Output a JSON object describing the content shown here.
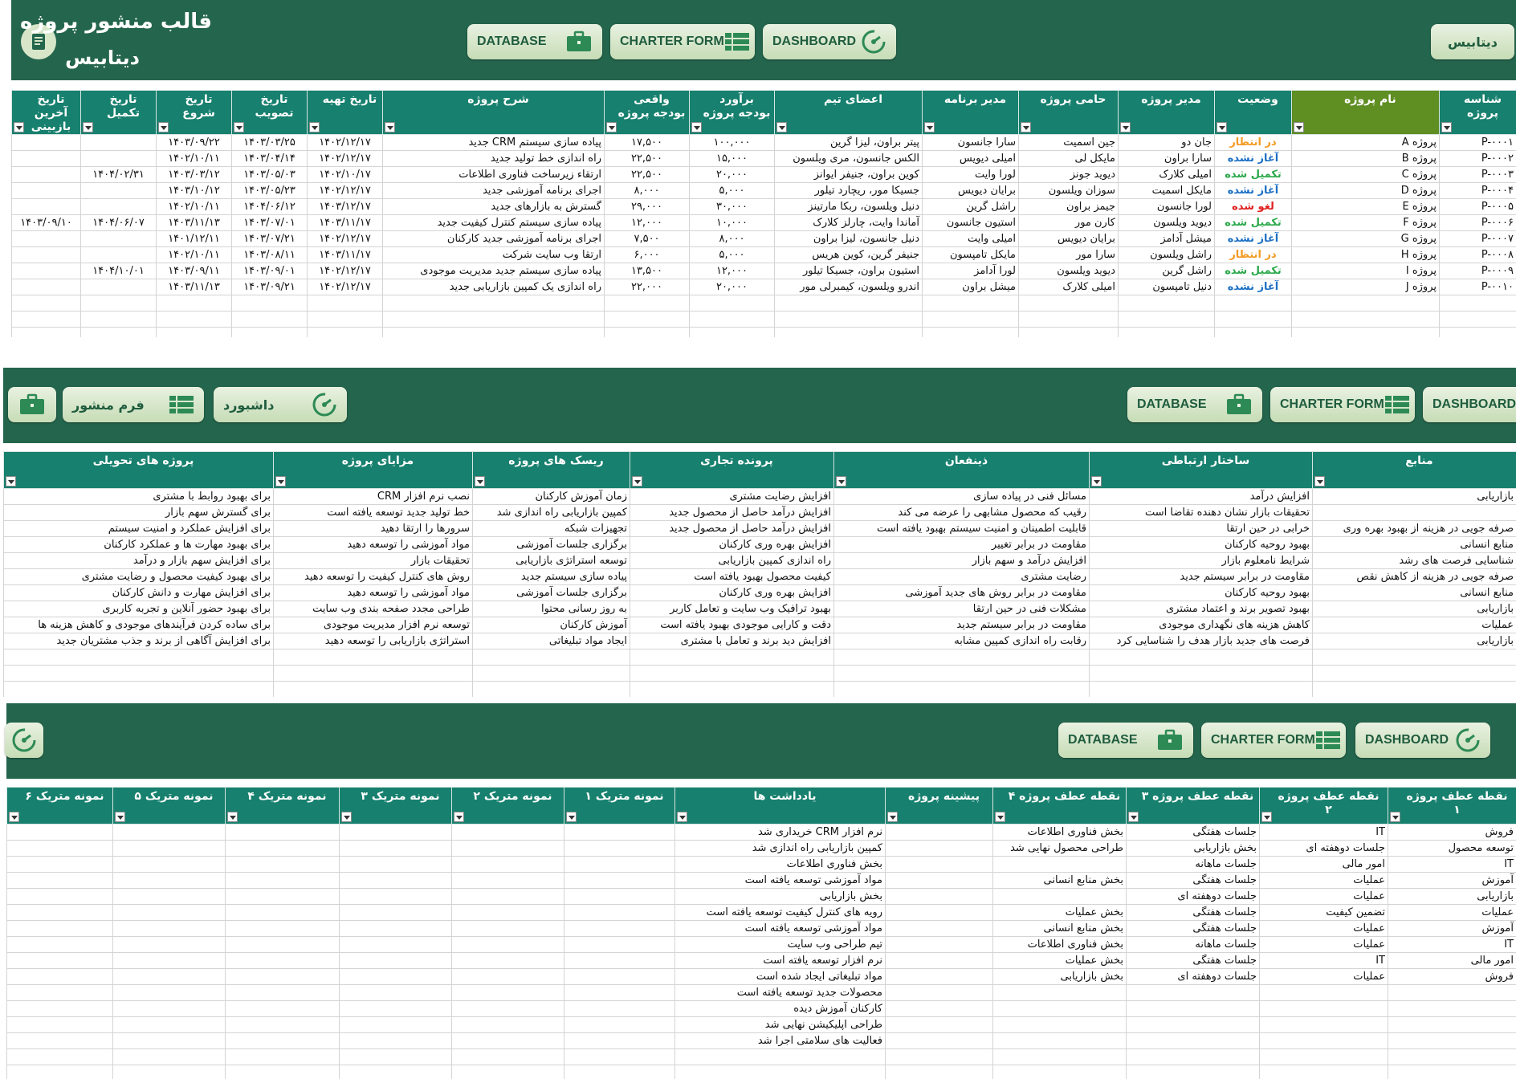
{
  "nav": {
    "database": "DATABASE",
    "charter_form": "CHARTER FORM",
    "dashboard": "DASHBOARD",
    "database_fa": "دیتابیس",
    "charter_fa": "فرم منشور",
    "dashboard_fa": "داشبورد"
  },
  "header": {
    "title": "قالب منشور پروژه",
    "subtitle": "دیتابیس"
  },
  "projects": {
    "headers": [
      "شناسه پروژه",
      "نام پروژه",
      "وضعیت",
      "مدیر پروژه",
      "حامی پروژه",
      "مدیر برنامه",
      "اعضای تیم",
      "برآورد بودجه پروژه",
      "واقعی بودجه پروژه",
      "شرح پروژه",
      "تاریخ تهیه",
      "تاریخ تصویب",
      "تاریخ شروع",
      "تاریخ تکمیل",
      "تاریخ آخرین بازبینی"
    ],
    "rows": [
      [
        "P-۰۰۰۱",
        "پروژه A",
        "در انتظار",
        "جان دو",
        "جین اسمیت",
        "سارا جانسون",
        "پیتر براون، لیزا گرین",
        "۱۰۰,۰۰۰",
        "۱۷,۵۰۰",
        "پیاده سازی سیستم CRM جدید",
        "۱۴۰۲/۱۲/۱۷",
        "۱۴۰۳/۰۳/۲۵",
        "۱۴۰۳/۰۹/۲۲",
        "",
        ""
      ],
      [
        "P-۰۰۰۲",
        "پروژه B",
        "آغاز نشده",
        "سارا براون",
        "مایکل لی",
        "امیلی دیویس",
        "الکس جانسون، مری ویلسون",
        "۱۵,۰۰۰",
        "۲۲,۵۰۰",
        "راه اندازی خط تولید جدید",
        "۱۴۰۲/۱۲/۱۷",
        "۱۴۰۳/۰۴/۱۴",
        "۱۴۰۲/۱۰/۱۱",
        "",
        ""
      ],
      [
        "P-۰۰۰۳",
        "پروژه C",
        "تکمیل شده",
        "امیلی کلارک",
        "دیوید جونز",
        "لورا وایت",
        "کوین براون، جنیفر ایوانز",
        "۲۰,۰۰۰",
        "۲۲,۵۰۰",
        "ارتقاء زیرساخت فناوری اطلاعات",
        "۱۴۰۲/۱۰/۱۷",
        "۱۴۰۳/۰۵/۰۳",
        "۱۴۰۳/۰۳/۱۲",
        "۱۴۰۴/۰۲/۳۱",
        ""
      ],
      [
        "P-۰۰۰۴",
        "پروژه D",
        "آغاز نشده",
        "مایکل اسمیت",
        "سوزان ویلسون",
        "برایان دیویس",
        "جسیکا مور، ریچارد تیلور",
        "۵,۰۰۰",
        "۸,۰۰۰",
        "اجرای برنامه آموزشی جدید",
        "۱۴۰۲/۱۲/۱۷",
        "۱۴۰۳/۰۵/۲۳",
        "۱۴۰۳/۱۰/۱۲",
        "",
        ""
      ],
      [
        "P-۰۰۰۵",
        "پروژه E",
        "لغو شده",
        "لورا جانسون",
        "جیمز براون",
        "راشل گرین",
        "دنیل ویلسون، ربکا مارتینز",
        "۳۰,۰۰۰",
        "۲۹,۰۰۰",
        "گسترش به بازارهای جدید",
        "۱۴۰۳/۱۲/۱۷",
        "۱۴۰۴/۰۶/۱۲",
        "۱۴۰۲/۱۰/۱۱",
        "",
        ""
      ],
      [
        "P-۰۰۰۶",
        "پروژه F",
        "تکمیل شده",
        "دیوید ویلسون",
        "کارن مور",
        "استیون جانسون",
        "آماندا وایت، چارلز کلارک",
        "۱۰,۰۰۰",
        "۱۲,۰۰۰",
        "پیاده سازی سیستم کنترل کیفیت جدید",
        "۱۴۰۳/۱۱/۱۷",
        "۱۴۰۳/۰۷/۰۱",
        "۱۴۰۳/۱۱/۱۳",
        "۱۴۰۴/۰۶/۰۷",
        "۱۴۰۳/۰۹/۱۰"
      ],
      [
        "P-۰۰۰۷",
        "پروژه G",
        "آغاز نشده",
        "میشل آدامز",
        "برایان دیویس",
        "امیلی وایت",
        "دنیل جانسون، لیزا براون",
        "۸,۰۰۰",
        "۷,۵۰۰",
        "اجرای برنامه آموزشی جدید کارکنان",
        "۱۴۰۲/۱۲/۱۷",
        "۱۴۰۳/۰۷/۲۱",
        "۱۴۰۱/۱۲/۱۱",
        "",
        ""
      ],
      [
        "P-۰۰۰۸",
        "پروژه H",
        "در انتظار",
        "راشل ویلسون",
        "سارا مور",
        "مایکل تامپسون",
        "جنیفر گرین، کوین هریس",
        "۵,۰۰۰",
        "۶,۰۰۰",
        "ارتقا وب سایت شرکت",
        "۱۴۰۳/۱۱/۱۷",
        "۱۴۰۳/۰۸/۱۱",
        "۱۴۰۲/۱۰/۱۱",
        "",
        ""
      ],
      [
        "P-۰۰۰۹",
        "پروژه I",
        "تکمیل شده",
        "راشل گرین",
        "دیوید ویلسون",
        "لورا آدامز",
        "استیون براون، جسیکا تیلور",
        "۱۲,۰۰۰",
        "۱۳,۵۰۰",
        "پیاده سازی سیستم جدید مدیریت موجودی",
        "۱۴۰۲/۱۲/۱۷",
        "۱۴۰۳/۰۹/۰۱",
        "۱۴۰۳/۰۹/۱۱",
        "۱۴۰۴/۱۰/۰۱",
        ""
      ],
      [
        "P-۰۰۱۰",
        "پروژه J",
        "آغاز نشده",
        "دنیل تامپسون",
        "امیلی کلارک",
        "میشل براون",
        "اندرو ویلسون، کیمبرلی مور",
        "۲۰,۰۰۰",
        "۲۲,۰۰۰",
        "راه اندازی یک کمپین بازاریابی جدید",
        "۱۴۰۲/۱۲/۱۷",
        "۱۴۰۳/۰۹/۲۱",
        "۱۴۰۳/۱۱/۱۳",
        "",
        ""
      ]
    ]
  },
  "charter": {
    "headers": [
      "منابع",
      "ساختار ارتباطی",
      "ذینفعان",
      "پرونده تجاری",
      "ریسک های پروژه",
      "مزایای پروژه",
      "پروژه های تحویلی"
    ],
    "rows": [
      [
        "بازاریابی",
        "افزایش درآمد",
        "مسائل فنی در پیاده سازی",
        "افزایش رضایت مشتری",
        "زمان آموزش کارکنان",
        "نصب نرم افزار CRM",
        "برای بهبود روابط با مشتری"
      ],
      [
        "",
        "تحقیقات بازار نشان دهنده تقاضا است",
        "رقیب که محصول مشابهی را عرضه می کند",
        "افزایش درآمد حاصل از محصول جدید",
        "کمپین بازاریابی راه اندازی شد",
        "خط تولید جدید توسعه یافته است",
        "برای گسترش سهم بازار"
      ],
      [
        "صرفه جویی در هزینه از بهبود بهره وری",
        "خرابی در حین ارتقا",
        "قابلیت اطمینان و امنیت سیستم بهبود یافته است",
        "افزایش درآمد حاصل از محصول جدید",
        "تجهیزات شبکه",
        "سرورها را ارتقا دهید",
        "برای افزایش عملکرد و امنیت سیستم"
      ],
      [
        "منابع انسانی",
        "بهبود روحیه کارکنان",
        "مقاومت در برابر تغییر",
        "افزایش بهره وری کارکنان",
        "برگزاری جلسات آموزشی",
        "مواد آموزشی را توسعه دهید",
        "برای بهبود مهارت ها و عملکرد کارکنان"
      ],
      [
        "شناسایی فرصت های رشد",
        "شرایط نامعلوم بازار",
        "افزایش درآمد و سهم بازار",
        "راه اندازی کمپین بازاریابی",
        "توسعه استراتژی بازاریابی",
        "تحقیقات بازار",
        "برای افزایش سهم بازار و درآمد"
      ],
      [
        "صرفه جویی در هزینه از کاهش نقص",
        "مقاومت در برابر سیستم جدید",
        "رضایت مشتری",
        "کیفیت محصول بهبود یافته است",
        "پیاده سازی سیستم جدید",
        "روش های کنترل کیفیت را توسعه دهید",
        "برای بهبود کیفیت محصول و رضایت مشتری"
      ],
      [
        "منابع انسانی",
        "بهبود روحیه کارکنان",
        "مقاومت در برابر روش های جدید آموزشی",
        "افزایش بهره وری کارکنان",
        "برگزاری جلسات آموزشی",
        "مواد آموزشی را توسعه دهید",
        "برای افزایش مهارت و دانش کارکنان"
      ],
      [
        "بازاریابی",
        "بهبود تصویر برند و اعتماد مشتری",
        "مشکلات فنی در حین ارتقا",
        "بهبود ترافیک وب سایت و تعامل کاربر",
        "به روز رسانی محتوا",
        "طراحی مجدد صفحه بندی وب سایت",
        "برای بهبود حضور آنلاین و تجربه کاربری"
      ],
      [
        "عملیات",
        "کاهش هزینه های نگهداری موجودی",
        "مقاومت در برابر سیستم جدید",
        "دقت و کارایی موجودی بهبود یافته است",
        "آموزش کارکنان",
        "توسعه نرم افزار مدیریت موجودی",
        "برای ساده کردن فرآیندهای موجودی و کاهش هزینه ها"
      ],
      [
        "بازاریابی",
        "فرصت های جدید بازار هدف را شناسایی کرد",
        "رقابت راه اندازی کمپین مشابه",
        "افزایش دید برند و تعامل با مشتری",
        "ایجاد مواد تبلیغاتی",
        "استراتژی بازاریابی را توسعه دهید",
        "برای افزایش آگاهی از برند و جذب مشتریان جدید"
      ]
    ]
  },
  "milestones": {
    "headers": [
      "نقطه عطف پروژه ۱",
      "نقطه عطف پروژه ۲",
      "نقطه عطف پروژه ۳",
      "نقطه عطف پروژه ۴",
      "پیشینه پروژه",
      "یادداشت ها",
      "نمونه متریک ۱",
      "نمونه متریک ۲",
      "نمونه متریک ۳",
      "نمونه متریک ۴",
      "نمونه متریک ۵",
      "نمونه متریک ۶"
    ],
    "rows": [
      [
        "فروش",
        "IT",
        "جلسات هفتگی",
        "بخش فناوری اطلاعات",
        "",
        "نرم افزار CRM خریداری شد",
        "",
        "",
        "",
        "",
        "",
        ""
      ],
      [
        "توسعه محصول",
        "جلسات دوهفته ای",
        "بخش بازاریابی",
        "طراحی محصول نهایی شد",
        "",
        "کمپین بازاریابی راه اندازی شد",
        "",
        "",
        "",
        "",
        "",
        ""
      ],
      [
        "IT",
        "امور مالی",
        "جلسات ماهانه",
        "",
        "",
        "بخش فناوری اطلاعات",
        "",
        "",
        "",
        "",
        "",
        ""
      ],
      [
        "آموزش",
        "عملیات",
        "جلسات هفتگی",
        "بخش منابع انسانی",
        "",
        "مواد آموزشی توسعه یافته است",
        "",
        "",
        "",
        "",
        "",
        ""
      ],
      [
        "بازاریابی",
        "عملیات",
        "جلسات دوهفته ای",
        "",
        "",
        "بخش بازاریابی",
        "",
        "",
        "",
        "",
        "",
        ""
      ],
      [
        "عملیات",
        "تضمین کیفیت",
        "جلسات هفتگی",
        "بخش عملیات",
        "",
        "رویه های کنترل کیفیت توسعه یافته است",
        "",
        "",
        "",
        "",
        "",
        ""
      ],
      [
        "آموزش",
        "عملیات",
        "جلسات هفتگی",
        "بخش منابع انسانی",
        "",
        "مواد آموزشی توسعه یافته است",
        "",
        "",
        "",
        "",
        "",
        ""
      ],
      [
        "IT",
        "عملیات",
        "جلسات ماهانه",
        "بخش فناوری اطلاعات",
        "",
        "تیم طراحی وب سایت",
        "",
        "",
        "",
        "",
        "",
        ""
      ],
      [
        "امور مالی",
        "IT",
        "جلسات هفتگی",
        "بخش عملیات",
        "",
        "نرم افزار توسعه یافته است",
        "",
        "",
        "",
        "",
        "",
        ""
      ],
      [
        "فروش",
        "عملیات",
        "جلسات دوهفته ای",
        "بخش بازاریابی",
        "",
        "مواد تبلیغاتی ایجاد شده است",
        "",
        "",
        "",
        "",
        "",
        ""
      ],
      [
        "",
        "",
        "",
        "",
        "",
        "محصولات جدید توسعه یافته است",
        "",
        "",
        "",
        "",
        "",
        ""
      ],
      [
        "",
        "",
        "",
        "",
        "",
        "کارکنان آموزش دیده",
        "",
        "",
        "",
        "",
        "",
        ""
      ],
      [
        "",
        "",
        "",
        "",
        "",
        "طراحی اپلیکیشن نهایی شد",
        "",
        "",
        "",
        "",
        "",
        ""
      ],
      [
        "",
        "",
        "",
        "",
        "",
        "فعالیت های سلامتی اجرا شد",
        "",
        "",
        "",
        "",
        "",
        ""
      ]
    ]
  },
  "status_classes": {
    "در انتظار": "st-wait",
    "آغاز نشده": "st-start",
    "تکمیل شده": "st-done",
    "لغو شده": "st-cancel"
  }
}
